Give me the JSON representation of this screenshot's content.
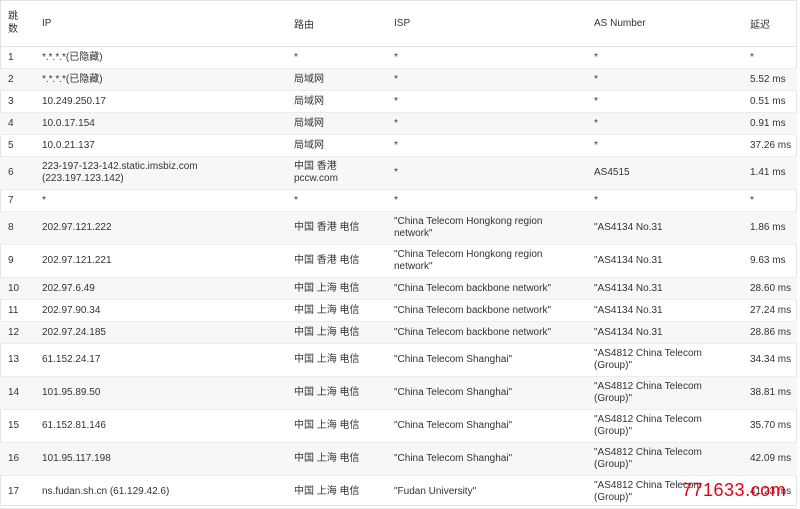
{
  "headers": {
    "hop": "跳数",
    "ip": "IP",
    "route": "路由",
    "isp": "ISP",
    "as": "AS Number",
    "latency": "延迟"
  },
  "rows": [
    {
      "hop": "1",
      "ip": "*.*.*.*(已隐藏)",
      "route": "*",
      "isp": "*",
      "as": "*",
      "latency": "*"
    },
    {
      "hop": "2",
      "ip": "*.*.*.*(已隐藏)",
      "route": "局域网",
      "isp": "*",
      "as": "*",
      "latency": "5.52 ms"
    },
    {
      "hop": "3",
      "ip": "10.249.250.17",
      "route": "局域网",
      "isp": "*",
      "as": "*",
      "latency": "0.51 ms"
    },
    {
      "hop": "4",
      "ip": "10.0.17.154",
      "route": "局域网",
      "isp": "*",
      "as": "*",
      "latency": "0.91 ms"
    },
    {
      "hop": "5",
      "ip": "10.0.21.137",
      "route": "局域网",
      "isp": "*",
      "as": "*",
      "latency": "37.26 ms"
    },
    {
      "hop": "6",
      "ip": "223-197-123-142.static.imsbiz.com\n(223.197.123.142)",
      "route": "中国 香港\npccw.com",
      "isp": "*",
      "as": "AS4515",
      "latency": "1.41 ms"
    },
    {
      "hop": "7",
      "ip": "*",
      "route": "*",
      "isp": "*",
      "as": "*",
      "latency": "*"
    },
    {
      "hop": "8",
      "ip": "202.97.121.222",
      "route": "中国 香港 电信",
      "isp": "\"China Telecom Hongkong region\nnetwork\"",
      "as": "\"AS4134 No.31",
      "latency": "1.86 ms"
    },
    {
      "hop": "9",
      "ip": "202.97.121.221",
      "route": "中国 香港 电信",
      "isp": "\"China Telecom Hongkong region\nnetwork\"",
      "as": "\"AS4134 No.31",
      "latency": "9.63 ms"
    },
    {
      "hop": "10",
      "ip": "202.97.6.49",
      "route": "中国 上海 电信",
      "isp": "\"China Telecom backbone network\"",
      "as": "\"AS4134 No.31",
      "latency": "28.60 ms"
    },
    {
      "hop": "11",
      "ip": "202.97.90.34",
      "route": "中国 上海 电信",
      "isp": "\"China Telecom backbone network\"",
      "as": "\"AS4134 No.31",
      "latency": "27.24 ms"
    },
    {
      "hop": "12",
      "ip": "202.97.24.185",
      "route": "中国 上海 电信",
      "isp": "\"China Telecom backbone network\"",
      "as": "\"AS4134 No.31",
      "latency": "28.86 ms"
    },
    {
      "hop": "13",
      "ip": "61.152.24.17",
      "route": "中国 上海 电信",
      "isp": "\"China Telecom Shanghai\"",
      "as": "\"AS4812 China Telecom\n(Group)\"",
      "latency": "34.34 ms"
    },
    {
      "hop": "14",
      "ip": "101.95.89.50",
      "route": "中国 上海 电信",
      "isp": "\"China Telecom Shanghai\"",
      "as": "\"AS4812 China Telecom\n(Group)\"",
      "latency": "38.81 ms"
    },
    {
      "hop": "15",
      "ip": "61.152.81.146",
      "route": "中国 上海 电信",
      "isp": "\"China Telecom Shanghai\"",
      "as": "\"AS4812 China Telecom\n(Group)\"",
      "latency": "35.70 ms"
    },
    {
      "hop": "16",
      "ip": "101.95.117.198",
      "route": "中国 上海 电信",
      "isp": "\"China Telecom Shanghai\"",
      "as": "\"AS4812 China Telecom\n(Group)\"",
      "latency": "42.09 ms"
    },
    {
      "hop": "17",
      "ip": "ns.fudan.sh.cn (61.129.42.6)",
      "route": "中国 上海 电信",
      "isp": "\"Fudan University\"",
      "as": "\"AS4812 China Telecom\n(Group)\"",
      "latency": "41.23 ms"
    }
  ],
  "watermark": "771633.com"
}
